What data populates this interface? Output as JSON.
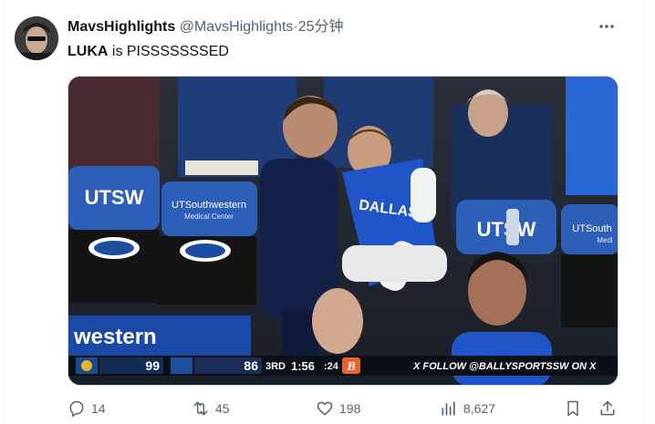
{
  "tweet": {
    "display_name": "MavsHighlights",
    "handle": "@MavsHighlights",
    "separator": "·",
    "time": "25分钟",
    "text_bold": "LUKA",
    "text_rest": " is PISSSSSSSED"
  },
  "media": {
    "scorebug": {
      "team1_score": "99",
      "team2_score": "86",
      "quarter": "3RD",
      "clock": "1:56",
      "shot_clock": ":24",
      "banner": "X FOLLOW @BALLYSPORTSSW ON X"
    },
    "signage": {
      "utsw": "UTSW",
      "utsw_partial": "UTSW",
      "ut_southwestern": "UTSouthwestern",
      "medical_center": "Medical Center",
      "ut_south_partial": "UTSouth",
      "med_partial": "Medi",
      "western": "western"
    },
    "jersey_text": "DALLAS"
  },
  "actions": {
    "replies": "14",
    "reposts": "45",
    "likes": "198",
    "views": "8,627"
  },
  "icons": [
    "more-icon",
    "reply-icon",
    "repost-icon",
    "like-icon",
    "views-icon",
    "bookmark-icon",
    "share-icon"
  ]
}
